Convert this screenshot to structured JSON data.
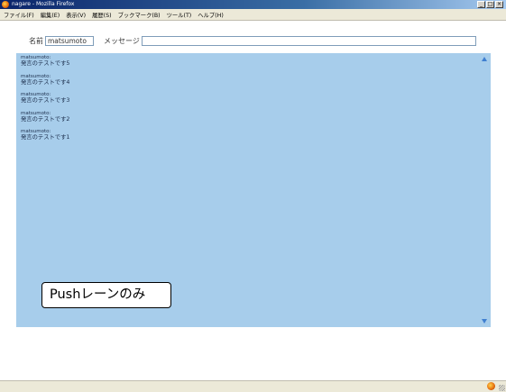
{
  "window": {
    "title": "nagare - Mozilla Firefox",
    "icon": "firefox-icon"
  },
  "menu": {
    "items": [
      "ファイル(F)",
      "編集(E)",
      "表示(V)",
      "履歴(S)",
      "ブックマーク(B)",
      "ツール(T)",
      "ヘルプ(H)"
    ]
  },
  "form": {
    "name_label": "名前",
    "name_value": "matsumoto",
    "message_label": "メッセージ",
    "message_value": ""
  },
  "messages": [
    {
      "user": "matsumoto:",
      "text": "発言のテストです5"
    },
    {
      "user": "matsumoto:",
      "text": "発言のテストです4"
    },
    {
      "user": "matsumoto:",
      "text": "発言のテストです3"
    },
    {
      "user": "matsumoto:",
      "text": "発言のテストです2"
    },
    {
      "user": "matsumoto:",
      "text": "発言のテストです1"
    }
  ],
  "callout": {
    "text": "Pushレーンのみ"
  },
  "colors": {
    "chat_panel_bg": "#a7cdeb",
    "scroll_arrow": "#3f7fd0"
  }
}
